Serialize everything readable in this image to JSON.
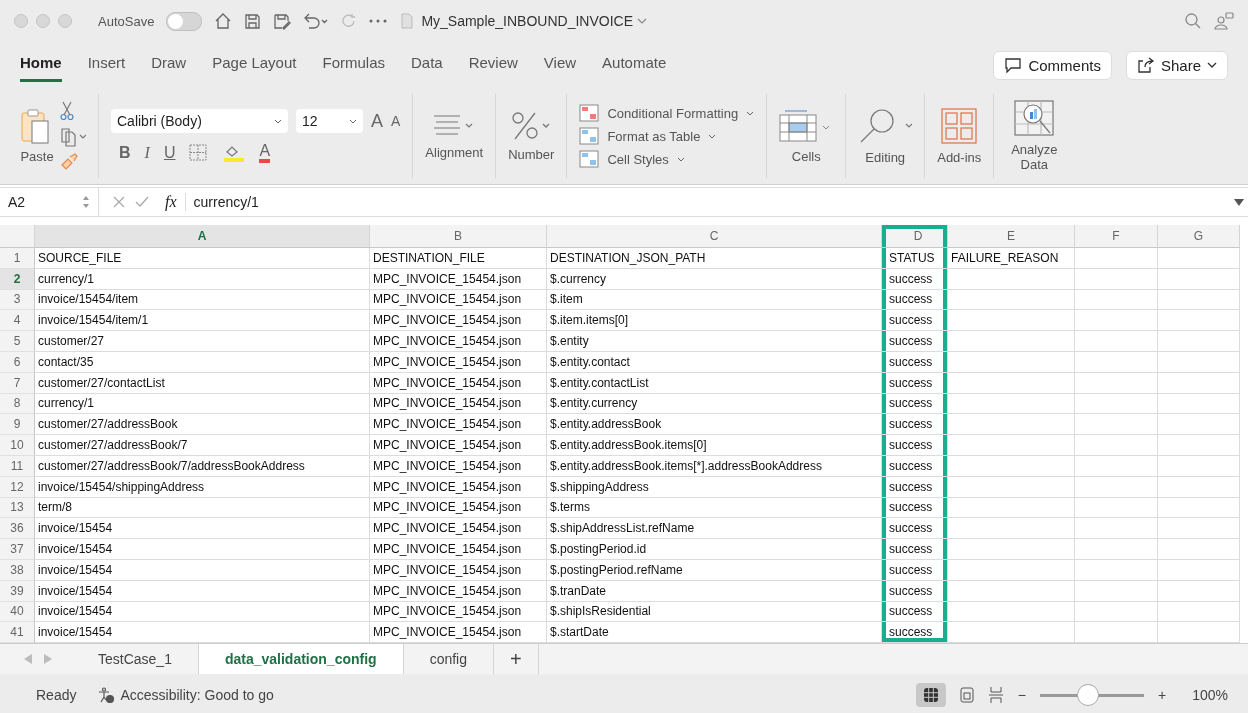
{
  "window": {
    "title": "My_Sample_INBOUND_INVOICE",
    "autosave_label": "AutoSave",
    "autosave_on": false
  },
  "ribbon_tabs": [
    {
      "label": "Home",
      "selected": true
    },
    {
      "label": "Insert",
      "selected": false
    },
    {
      "label": "Draw",
      "selected": false
    },
    {
      "label": "Page Layout",
      "selected": false
    },
    {
      "label": "Formulas",
      "selected": false
    },
    {
      "label": "Data",
      "selected": false
    },
    {
      "label": "Review",
      "selected": false
    },
    {
      "label": "View",
      "selected": false
    },
    {
      "label": "Automate",
      "selected": false
    }
  ],
  "header_buttons": [
    "Comments",
    "Share"
  ],
  "ribbon": {
    "paste_label": "Paste",
    "font_name": "Calibri (Body)",
    "font_size": "12",
    "grow_font": "A",
    "shrink_font": "A",
    "bold": "B",
    "italic": "I",
    "underline": "U",
    "font_color": "A",
    "alignment_label": "Alignment",
    "number_label": "Number",
    "styles": [
      "Conditional Formatting",
      "Format as Table",
      "Cell Styles"
    ],
    "cells_label": "Cells",
    "editing_label": "Editing",
    "addins_label": "Add-ins",
    "analyze_label": "Analyze Data"
  },
  "formula_bar": {
    "cell_ref": "A2",
    "fx": "fx",
    "value": "currency/1"
  },
  "columns": [
    {
      "letter": "A",
      "selected": true,
      "highlighted": false
    },
    {
      "letter": "B",
      "selected": false,
      "highlighted": false
    },
    {
      "letter": "C",
      "selected": false,
      "highlighted": false
    },
    {
      "letter": "D",
      "selected": false,
      "highlighted": true
    },
    {
      "letter": "E",
      "selected": false,
      "highlighted": false
    },
    {
      "letter": "F",
      "selected": false,
      "highlighted": false
    },
    {
      "letter": "G",
      "selected": false,
      "highlighted": false
    }
  ],
  "rows": [
    {
      "number": "1",
      "selected": false,
      "cells": [
        "SOURCE_FILE",
        "DESTINATION_FILE",
        "DESTINATION_JSON_PATH",
        "STATUS",
        "FAILURE_REASON"
      ]
    },
    {
      "number": "2",
      "selected": true,
      "cells": [
        "currency/1",
        "MPC_INVOICE_15454.json",
        "$.currency",
        "success"
      ]
    },
    {
      "number": "3",
      "selected": false,
      "cells": [
        "invoice/15454/item",
        "MPC_INVOICE_15454.json",
        "$.item",
        "success"
      ]
    },
    {
      "number": "4",
      "selected": false,
      "cells": [
        "invoice/15454/item/1",
        "MPC_INVOICE_15454.json",
        "$.item.items[0]",
        "success"
      ]
    },
    {
      "number": "5",
      "selected": false,
      "cells": [
        "customer/27",
        "MPC_INVOICE_15454.json",
        "$.entity",
        "success"
      ]
    },
    {
      "number": "6",
      "selected": false,
      "cells": [
        "contact/35",
        "MPC_INVOICE_15454.json",
        "$.entity.contact",
        "success"
      ]
    },
    {
      "number": "7",
      "selected": false,
      "cells": [
        "customer/27/contactList",
        "MPC_INVOICE_15454.json",
        "$.entity.contactList",
        "success"
      ]
    },
    {
      "number": "8",
      "selected": false,
      "cells": [
        "currency/1",
        "MPC_INVOICE_15454.json",
        "$.entity.currency",
        "success"
      ]
    },
    {
      "number": "9",
      "selected": false,
      "cells": [
        "customer/27/addressBook",
        "MPC_INVOICE_15454.json",
        "$.entity.addressBook",
        "success"
      ]
    },
    {
      "number": "10",
      "selected": false,
      "cells": [
        "customer/27/addressBook/7",
        "MPC_INVOICE_15454.json",
        "$.entity.addressBook.items[0]",
        "success"
      ]
    },
    {
      "number": "11",
      "selected": false,
      "cells": [
        "customer/27/addressBook/7/addressBookAddress",
        "MPC_INVOICE_15454.json",
        "$.entity.addressBook.items[*].addressBookAddress",
        "success"
      ]
    },
    {
      "number": "12",
      "selected": false,
      "cells": [
        "invoice/15454/shippingAddress",
        "MPC_INVOICE_15454.json",
        "$.shippingAddress",
        "success"
      ]
    },
    {
      "number": "13",
      "selected": false,
      "cells": [
        "term/8",
        "MPC_INVOICE_15454.json",
        "$.terms",
        "success"
      ]
    },
    {
      "number": "36",
      "selected": false,
      "cells": [
        "invoice/15454",
        "MPC_INVOICE_15454.json",
        "$.shipAddressList.refName",
        "success"
      ]
    },
    {
      "number": "37",
      "selected": false,
      "cells": [
        "invoice/15454",
        "MPC_INVOICE_15454.json",
        "$.postingPeriod.id",
        "success"
      ]
    },
    {
      "number": "38",
      "selected": false,
      "cells": [
        "invoice/15454",
        "MPC_INVOICE_15454.json",
        "$.postingPeriod.refName",
        "success"
      ]
    },
    {
      "number": "39",
      "selected": false,
      "cells": [
        "invoice/15454",
        "MPC_INVOICE_15454.json",
        "$.tranDate",
        "success"
      ]
    },
    {
      "number": "40",
      "selected": false,
      "cells": [
        "invoice/15454",
        "MPC_INVOICE_15454.json",
        "$.shipIsResidential",
        "success"
      ]
    },
    {
      "number": "41",
      "selected": false,
      "cells": [
        "invoice/15454",
        "MPC_INVOICE_15454.json",
        "$.startDate",
        "success"
      ]
    }
  ],
  "sheet_tabs": [
    {
      "label": "TestCase_1",
      "selected": false
    },
    {
      "label": "data_validation_config",
      "selected": true
    },
    {
      "label": "config",
      "selected": false
    }
  ],
  "add_sheet": "+",
  "status_bar": {
    "ready": "Ready",
    "accessibility": "Accessibility: Good to go",
    "zoom_minus": "−",
    "zoom_plus": "+",
    "zoom": "100%",
    "level": 0.45
  }
}
